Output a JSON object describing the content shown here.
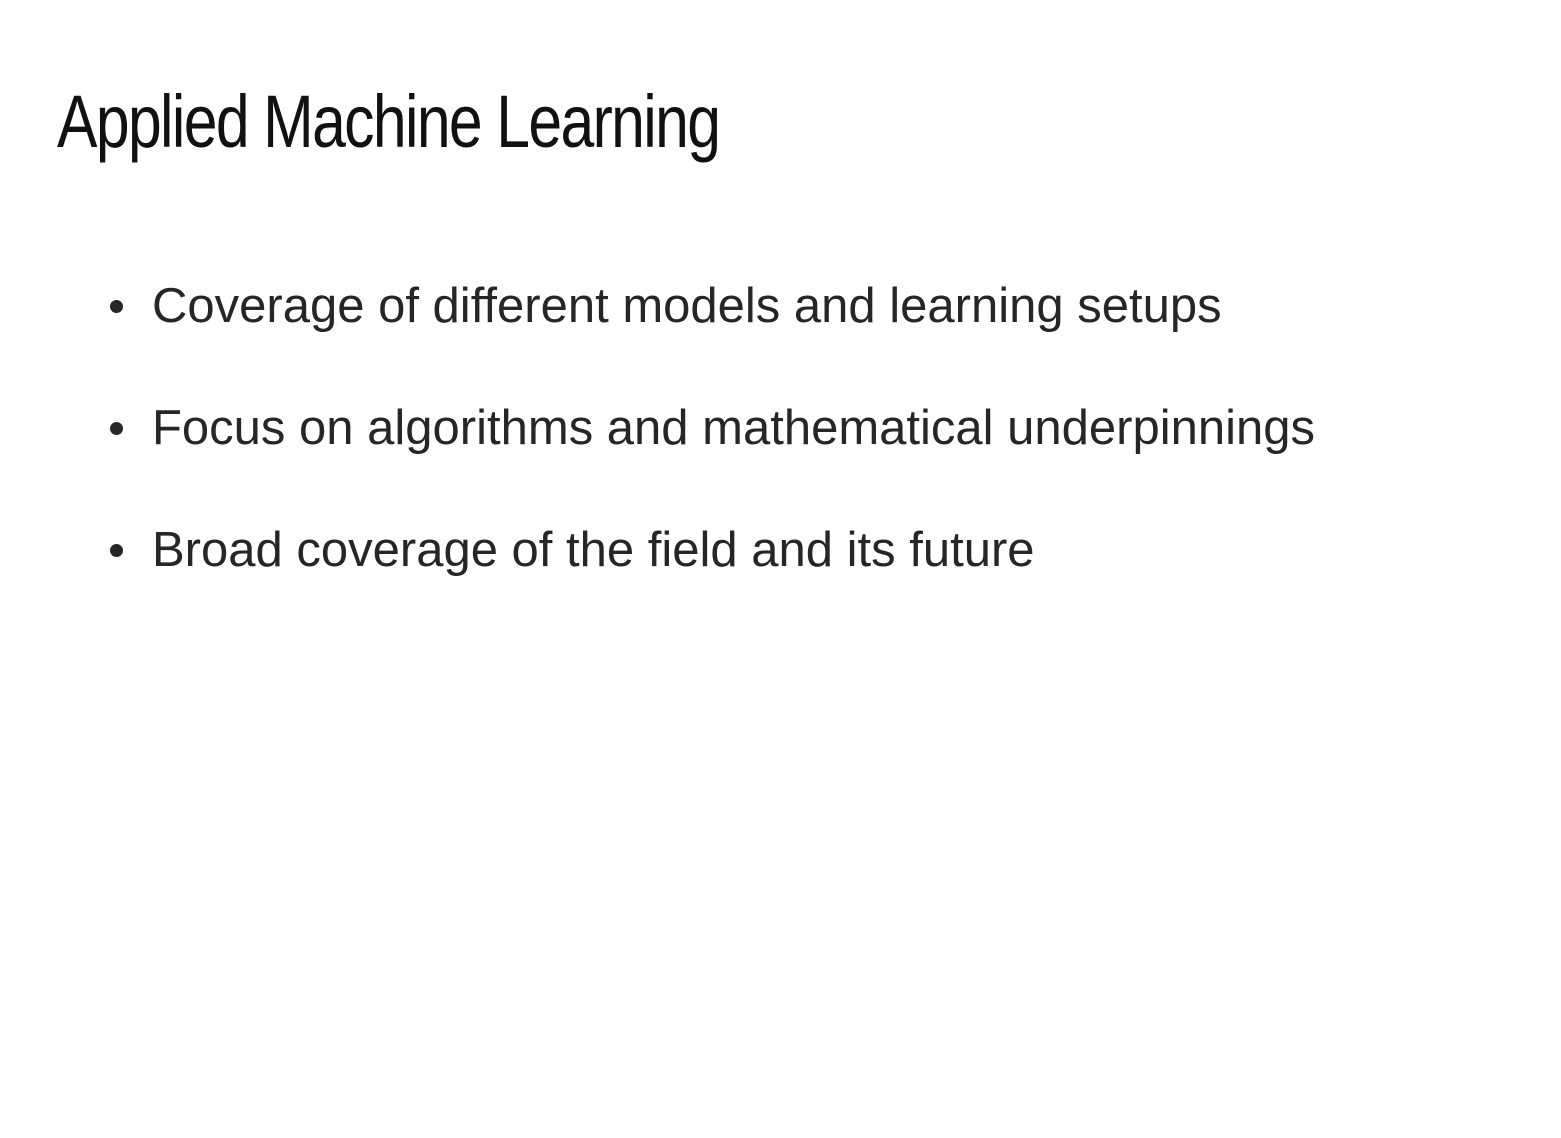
{
  "slide": {
    "title": "Applied Machine Learning",
    "bullets": [
      "Coverage of different models and learning setups",
      "Focus on algorithms and mathematical underpinnings",
      "Broad coverage of the field and its future"
    ]
  }
}
